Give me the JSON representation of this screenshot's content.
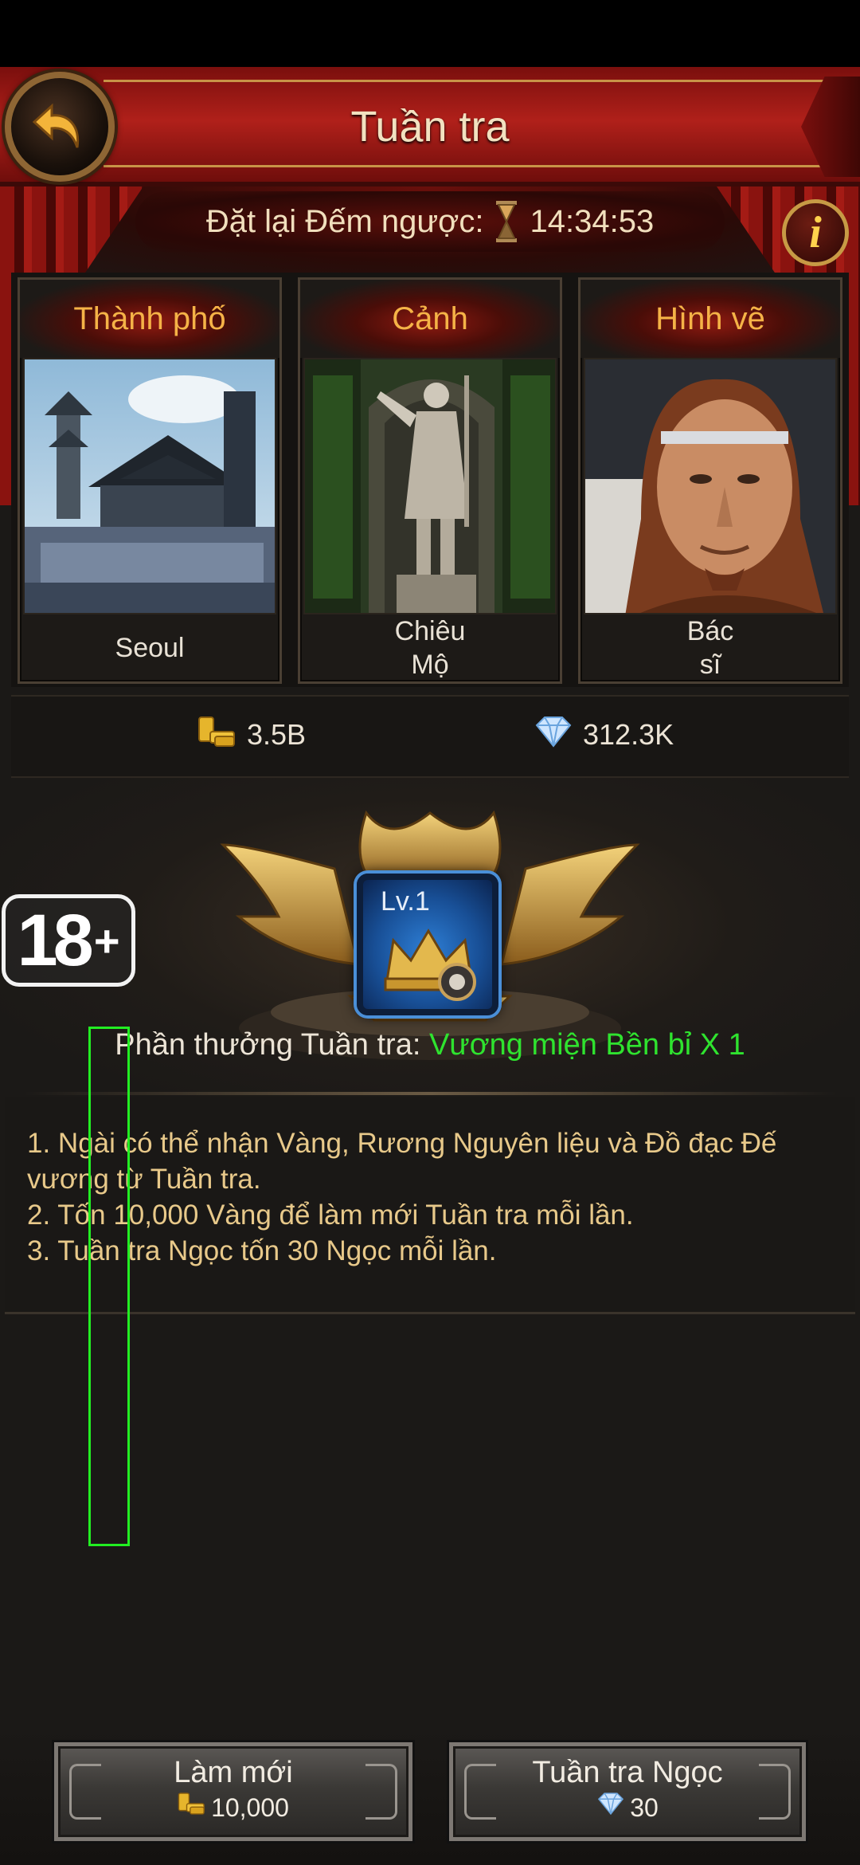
{
  "header": {
    "title": "Tuần tra"
  },
  "countdown": {
    "label": "Đặt lại Đếm ngược:",
    "time": "14:34:53"
  },
  "cards": [
    {
      "category": "Thành phố",
      "name": "Seoul"
    },
    {
      "category": "Cảnh",
      "name": "Chiêu\nMộ"
    },
    {
      "category": "Hình vẽ",
      "name": "Bác\nsĩ"
    }
  ],
  "resources": {
    "gold": "3.5B",
    "gems": "312.3K"
  },
  "emblem": {
    "level": "Lv.1"
  },
  "age_rating": {
    "number": "18",
    "plus": "+"
  },
  "reward": {
    "label": "Phần thưởng Tuần tra:",
    "value": "Vương miện Bền bỉ X 1"
  },
  "rules": [
    "1. Ngài có thể nhận Vàng, Rương Nguyên liệu và Đồ đạc Đế vương từ Tuần tra.",
    "2. Tốn 10,000 Vàng để làm mới Tuần tra mỗi lần.",
    "3. Tuần tra Ngọc tốn 30 Ngọc mỗi lần."
  ],
  "buttons": {
    "refresh": {
      "label": "Làm mới",
      "cost": "10,000"
    },
    "gem_patrol": {
      "label": "Tuần tra Ngọc",
      "cost": "30"
    }
  },
  "colors": {
    "header_red": "#b0201a",
    "card_title_orange": "#f5b347",
    "reward_green": "#2fe32f",
    "rules_text": "#e8c98a",
    "level_box_blue": "#2e7fd6"
  }
}
